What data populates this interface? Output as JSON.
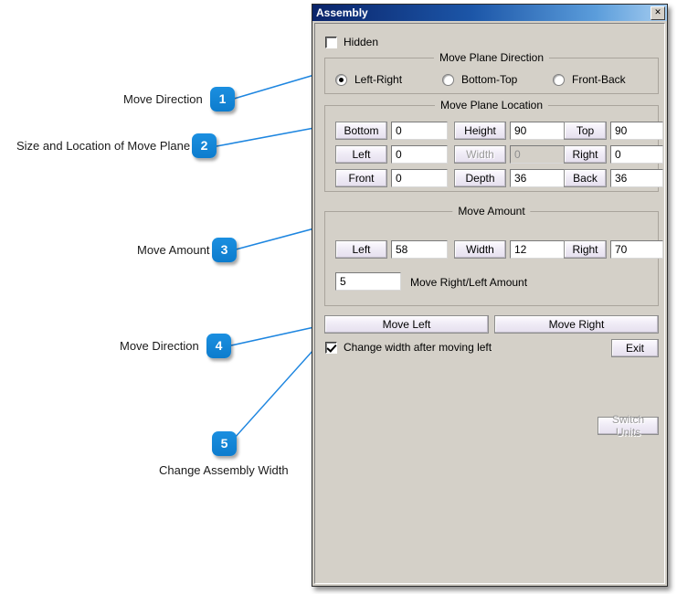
{
  "window": {
    "title": "Assembly",
    "close_icon": "close-icon",
    "close_glyph": "✕"
  },
  "hidden_checkbox": {
    "label": "Hidden",
    "checked": false
  },
  "move_plane_direction": {
    "title": "Move Plane Direction",
    "options": [
      {
        "label": "Left-Right",
        "selected": true
      },
      {
        "label": "Bottom-Top",
        "selected": false
      },
      {
        "label": "Front-Back",
        "selected": false
      }
    ]
  },
  "move_plane_location": {
    "title": "Move Plane Location",
    "rows": [
      {
        "cells": [
          {
            "button": "Bottom",
            "value": "0",
            "disabled": false
          },
          {
            "button": "Height",
            "value": "90",
            "disabled": false
          },
          {
            "button": "Top",
            "value": "90",
            "disabled": false
          }
        ]
      },
      {
        "cells": [
          {
            "button": "Left",
            "value": "0",
            "disabled": false
          },
          {
            "button": "Width",
            "value": "0",
            "disabled": true
          },
          {
            "button": "Right",
            "value": "0",
            "disabled": false
          }
        ]
      },
      {
        "cells": [
          {
            "button": "Front",
            "value": "0",
            "disabled": false
          },
          {
            "button": "Depth",
            "value": "36",
            "disabled": false
          },
          {
            "button": "Back",
            "value": "36",
            "disabled": false
          }
        ]
      }
    ]
  },
  "move_amount": {
    "title": "Move Amount",
    "cells": [
      {
        "button": "Left",
        "value": "58"
      },
      {
        "button": "Width",
        "value": "12"
      },
      {
        "button": "Right",
        "value": "70"
      }
    ],
    "amount_value": "5",
    "amount_label": "Move Right/Left Amount"
  },
  "actions": {
    "move_left": "Move Left",
    "move_right": "Move Right",
    "change_width_label": "Change width after moving left",
    "change_width_checked": true,
    "exit": "Exit",
    "switch_units": "Switch Units"
  },
  "annotations": [
    {
      "id": "1",
      "label": "Move Direction"
    },
    {
      "id": "2",
      "label": "Size and Location of Move Plane"
    },
    {
      "id": "3",
      "label": "Move Amount"
    },
    {
      "id": "4",
      "label": "Move Direction"
    },
    {
      "id": "5",
      "label": "Change Assembly Width"
    }
  ],
  "colors": {
    "badge": "#1083d6",
    "callout_line": "#1e86e0",
    "window_face": "#d4d0c8",
    "title_bar_start": "#0a246a",
    "title_bar_end": "#a6cdf0"
  }
}
